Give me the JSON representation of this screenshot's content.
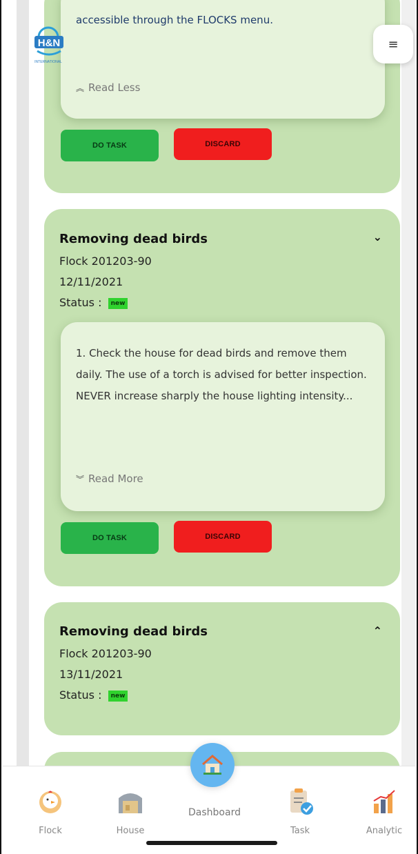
{
  "header": {
    "logo_text": "H&N",
    "logo_sub": "INTERNATIONAL",
    "menu_glyph": "≡"
  },
  "cards": [
    {
      "description": "accessible through the FLOCKS menu.",
      "read_toggle": "Read Less",
      "do_task": "DO TASK",
      "discard": "DISCARD"
    },
    {
      "title": "Removing dead birds",
      "flock": "Flock 201203-90",
      "date": "12/11/2021",
      "status_label": "Status :",
      "status": "new",
      "description": "1. Check the house for dead birds and remove them daily. The use of a torch is advised for better inspection. NEVER increase sharply the house lighting intensity...",
      "read_toggle": "Read More",
      "do_task": "DO TASK",
      "discard": "DISCARD"
    },
    {
      "title": "Removing dead birds",
      "flock": "Flock 201203-90",
      "date": "13/11/2021",
      "status_label": "Status :",
      "status": "new"
    }
  ],
  "nav": {
    "items": [
      {
        "label": "Flock",
        "icon": "chicken-icon"
      },
      {
        "label": "House",
        "icon": "barn-icon"
      },
      {
        "label": "Dashboard",
        "icon": "home-icon"
      },
      {
        "label": "Task",
        "icon": "task-clipboard-icon"
      },
      {
        "label": "Analytic",
        "icon": "bar-chart-icon"
      }
    ]
  },
  "colors": {
    "card_bg": "#c5e1b1",
    "inner_bg": "#e7f3dc",
    "do_task": "#29b34a",
    "discard": "#f01e1e",
    "status_new": "#30d22e",
    "fab": "#64b6f0"
  }
}
